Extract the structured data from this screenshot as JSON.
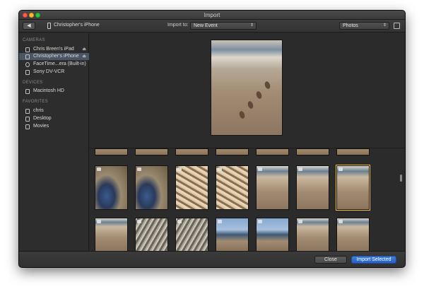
{
  "window": {
    "title": "Import"
  },
  "toolbar": {
    "device_name": "Christopher's iPhone",
    "import_to_label": "Import to:",
    "event_select_value": "New Event",
    "view_select_value": "Photos"
  },
  "sidebar": {
    "sections": [
      {
        "heading": "CAMERAS",
        "items": [
          {
            "label": "Chris Breen's iPad",
            "icon": "tablet-icon",
            "eject": true
          },
          {
            "label": "Christopher's iPhone",
            "icon": "phone-icon",
            "eject": true,
            "selected": true
          },
          {
            "label": "FaceTime...era (Built-in)",
            "icon": "camera-icon"
          },
          {
            "label": "Sony DV-VCR",
            "icon": "camcorder-icon"
          }
        ]
      },
      {
        "heading": "DEVICES",
        "items": [
          {
            "label": "Macintosh HD",
            "icon": "hard-drive-icon"
          }
        ]
      },
      {
        "heading": "FAVORITES",
        "items": [
          {
            "label": "chris",
            "icon": "home-icon"
          },
          {
            "label": "Desktop",
            "icon": "desktop-icon"
          },
          {
            "label": "Movies",
            "icon": "movies-icon"
          }
        ]
      }
    ]
  },
  "grid": {
    "rows": [
      [
        "strip",
        "strip",
        "strip",
        "strip",
        "strip",
        "strip",
        "strip"
      ],
      [
        "blue",
        "blue",
        "shell",
        "shell",
        "sand",
        "sand",
        "sand"
      ],
      [
        "sand",
        "rocks",
        "rocks",
        "ocean",
        "ocean",
        "sand",
        "sand"
      ]
    ],
    "selected_index": {
      "row": 1,
      "col": 6
    }
  },
  "buttons": {
    "close_label": "Close",
    "import_selected_label": "Import Selected"
  },
  "colors": {
    "accent": "#2761c4",
    "selection_highlight": "#f1c232",
    "window_bg": "#2a2a2a"
  }
}
